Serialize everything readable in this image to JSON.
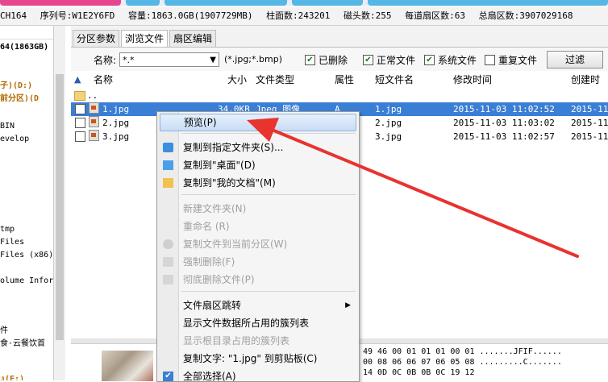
{
  "disk_info": {
    "model": "CH164",
    "serial": "序列号:W1E2Y6FD",
    "capacity": "容量:1863.0GB(1907729MB)",
    "cylinders": "柱面数:243201",
    "heads": "磁头数:255",
    "sectors_per_track": "每道扇区数:63",
    "total_sectors": "总扇区数:3907029168"
  },
  "tree": {
    "close": "×",
    "items": [
      "64(1863GB)",
      "子)(D:)",
      "前分区)(D",
      "BIN",
      "evelop",
      "tmp",
      "Files",
      "Files (x86)",
      "olume Infor",
      "件",
      "食·云餐饮首",
      "ᴊ(E:)"
    ]
  },
  "tabs": [
    "分区参数",
    "浏览文件",
    "扇区编辑"
  ],
  "filter": {
    "name_label": "名称:",
    "name_value": "*.*",
    "ext_hint": "(*.jpg;*.bmp)",
    "deleted": "已删除",
    "normal": "正常文件",
    "system": "系统文件",
    "duplicate": "重复文件",
    "filter_button": "过滤"
  },
  "columns": {
    "name": "名称",
    "size": "大小",
    "type": "文件类型",
    "attr": "属性",
    "short_name": "短文件名",
    "modified": "修改时间",
    "created": "创建时间"
  },
  "parent_dir": "..",
  "files": [
    {
      "name": "1.jpg",
      "size": "34.0KB",
      "type": "Jpeg 图像",
      "attr": "A",
      "short": "1.jpg",
      "modified": "2015-11-03 11:02:52",
      "created": "2015-11-"
    },
    {
      "name": "2.jpg",
      "size": "",
      "type": "",
      "attr": "",
      "short": "2.jpg",
      "modified": "2015-11-03 11:03:02",
      "created": "2015-11-"
    },
    {
      "name": "3.jpg",
      "size": "",
      "type": "",
      "attr": "",
      "short": "3.jpg",
      "modified": "2015-11-03 11:02:57",
      "created": "2015-11-"
    }
  ],
  "hex": [
    "49 46 00 01 01 01 00 01   .......JFIF......",
    "00 08 06 06 07 06 05 08   .........C.......",
    "14 0D 0C 0B 0B 0C 19 12"
  ],
  "menu": {
    "preview": "预览(P)",
    "copy_to_folder": "复制到指定文件夹(S)...",
    "copy_to_desktop": "复制到\"桌面\"(D)",
    "copy_to_docs": "复制到\"我的文档\"(M)",
    "new_folder": "新建文件夹(N)",
    "rename": "重命名 (R)",
    "copy_to_partition": "复制文件到当前分区(W)",
    "force_delete": "强制删除(F)",
    "wipe_delete": "彻底删除文件(P)",
    "sector_jump": "文件扇区跳转",
    "show_clusters": "显示文件数据所占用的簇列表",
    "show_root_clusters": "显示根目录占用的簇列表",
    "copy_text": "复制文字: \"1.jpg\" 到剪贴板(C)",
    "select_all": "全部选择(A)",
    "submenu_arrow": "▶"
  },
  "colors": {
    "selection": "#3a7fd5",
    "arrow": "#e8332f",
    "menu_highlight": "#c9ddf6"
  },
  "icons": {
    "up": "▲",
    "check": "✔",
    "dropdown": "▼"
  }
}
